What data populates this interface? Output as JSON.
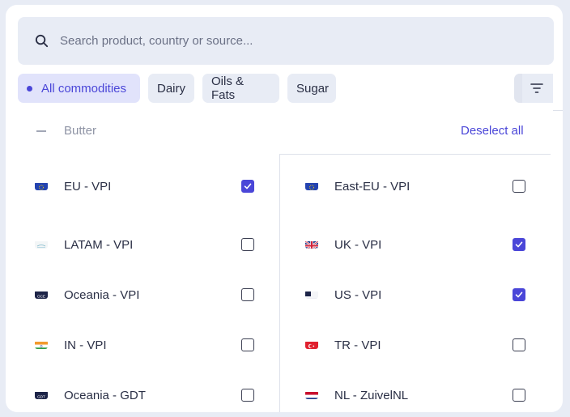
{
  "search": {
    "placeholder": "Search product, country or source..."
  },
  "chips": [
    {
      "label": "All commodities",
      "active": true
    },
    {
      "label": "Dairy",
      "active": false
    },
    {
      "label": "Oils & Fats",
      "active": false
    },
    {
      "label": "Sugar",
      "active": false
    }
  ],
  "group": {
    "name": "Butter",
    "deselect_label": "Deselect all"
  },
  "sources": [
    {
      "label": "EU - VPI",
      "checked": true,
      "flag": "eu-flag-icon"
    },
    {
      "label": "East-EU - VPI",
      "checked": false,
      "flag": "eu-flag-icon"
    },
    {
      "label": "LATAM - VPI",
      "checked": false,
      "flag": "latam-flag-icon"
    },
    {
      "label": "UK - VPI",
      "checked": true,
      "flag": "uk-flag-icon"
    },
    {
      "label": "Oceania - VPI",
      "checked": false,
      "flag": "oceania-oce-icon"
    },
    {
      "label": "US - VPI",
      "checked": true,
      "flag": "us-flag-icon"
    },
    {
      "label": "IN - VPI",
      "checked": false,
      "flag": "india-flag-icon"
    },
    {
      "label": "TR - VPI",
      "checked": false,
      "flag": "turkey-flag-icon"
    },
    {
      "label": "Oceania - GDT",
      "checked": false,
      "flag": "oceania-gdt-icon"
    },
    {
      "label": "NL - ZuivelNL",
      "checked": false,
      "flag": "netherlands-flag-icon"
    }
  ],
  "colors": {
    "accent": "#4a46d8",
    "chip_bg": "#e8ecf5",
    "active_chip_bg": "#e1e3fb"
  }
}
